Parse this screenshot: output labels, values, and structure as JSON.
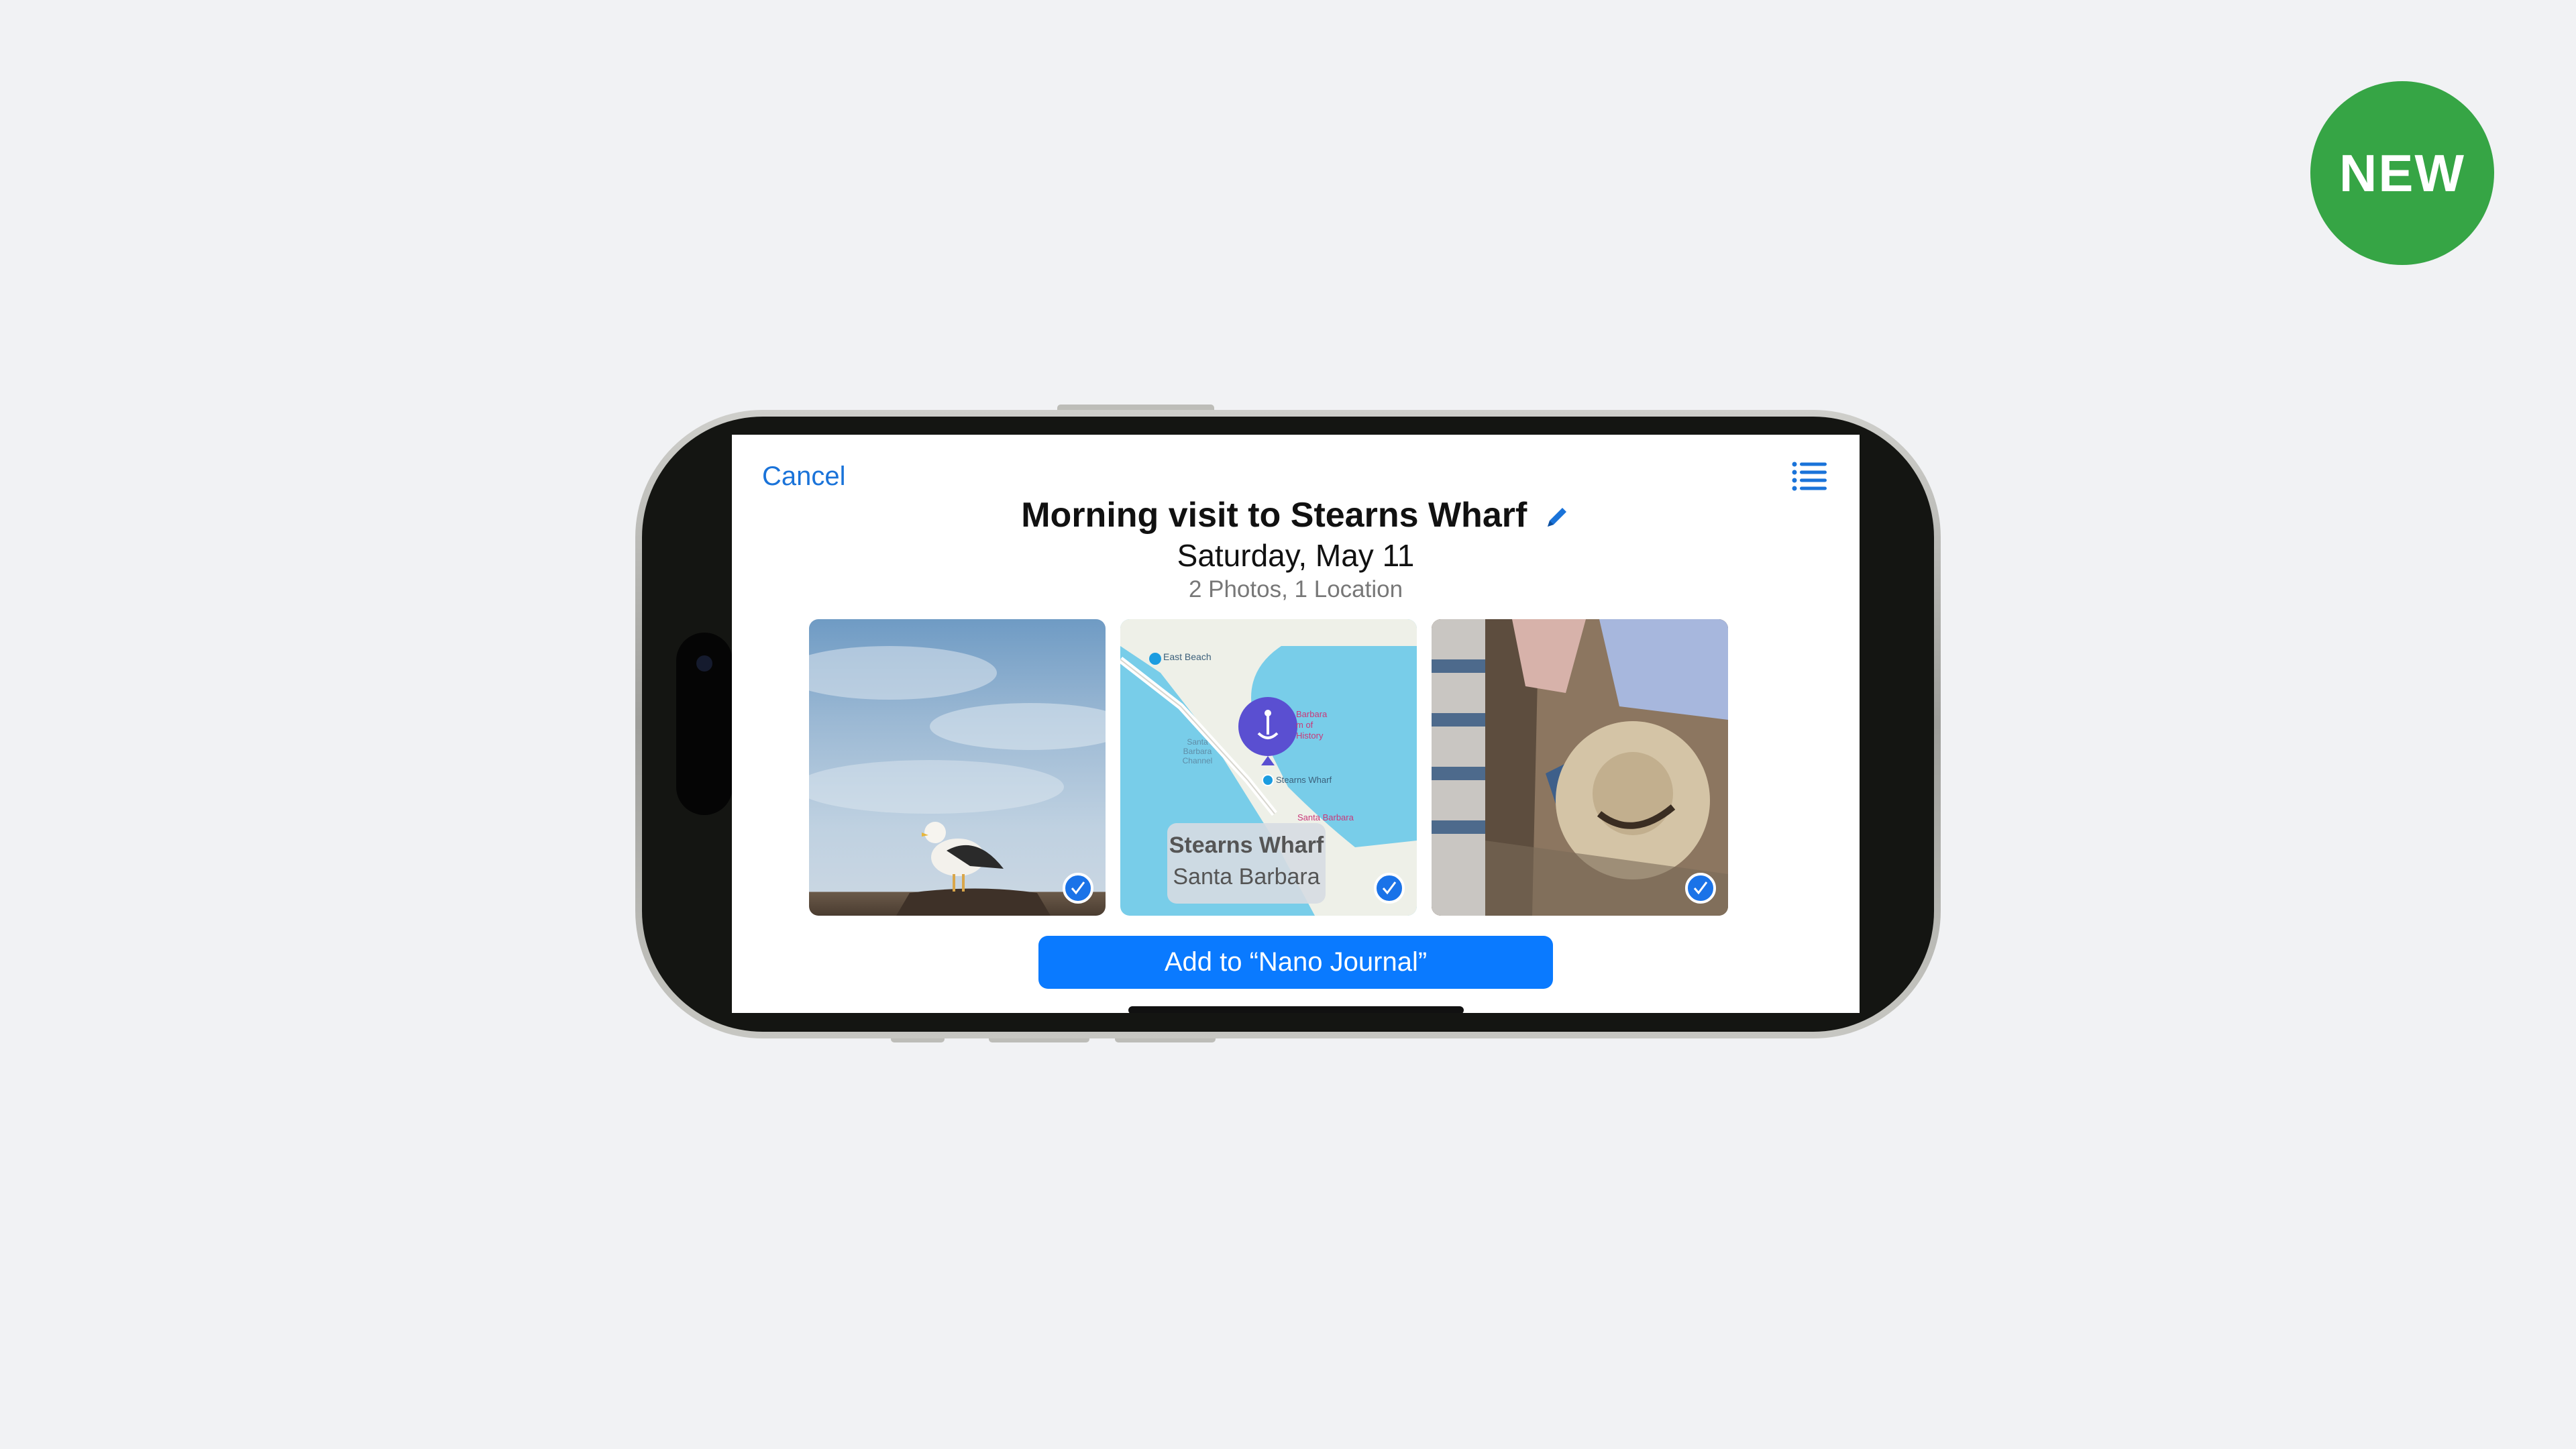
{
  "badge": {
    "label": "NEW",
    "color": "#36a545"
  },
  "sheet": {
    "cancel_label": "Cancel",
    "title": "Morning visit to Stearns Wharf",
    "date": "Saturday, May 11",
    "summary": "2 Photos, 1 Location",
    "add_button_label": "Add to “Nano Journal”",
    "accent_color": "#0a7aff"
  },
  "cards": [
    {
      "kind": "photo",
      "subject": "seagull on rock",
      "selected": true
    },
    {
      "kind": "map",
      "selected": true,
      "map_labels": [
        "East Beach",
        "Barbara",
        "m of",
        "History",
        "Santa Barbara Channel",
        "Stearns Wharf",
        "Santa Barbara"
      ],
      "location_name": "Stearns Wharf",
      "location_city": "Santa Barbara"
    },
    {
      "kind": "photo",
      "subject": "sun hat on beach towel",
      "selected": true
    }
  ],
  "icons": [
    "list-icon",
    "pencil-icon",
    "checkmark-icon",
    "map-pin-icon"
  ]
}
